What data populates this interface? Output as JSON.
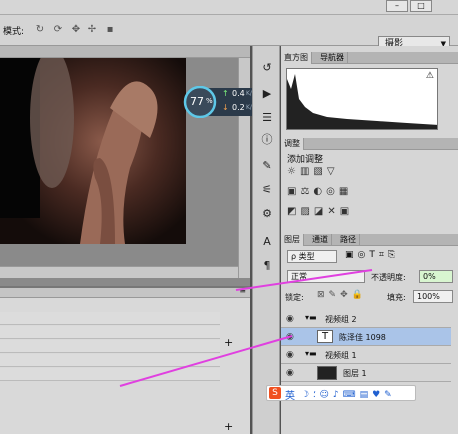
{
  "options": {
    "mode_label": "模式:",
    "workspace": "摄影"
  },
  "hud": {
    "cpu": "77",
    "cpu_unit": "%",
    "up": "0.4",
    "up_unit": "K/s",
    "down": "0.2",
    "down_unit": "K/s"
  },
  "panels": {
    "tabs_top": [
      "直方图",
      "导航器"
    ],
    "adjust_title": "调整",
    "adjust_add": "添加调整",
    "tabs_layers": [
      "图层",
      "通道",
      "路径"
    ]
  },
  "layers": {
    "filter": "类型",
    "blend": "正常",
    "opacity_label": "不透明度:",
    "opacity": "0%",
    "lock_label": "锁定:",
    "fill_label": "填充:",
    "fill": "100%",
    "rows": [
      {
        "name": "视频组 2",
        "type": "group"
      },
      {
        "name": "陈泽佳 1098",
        "type": "text"
      },
      {
        "name": "视频组 1",
        "type": "group"
      },
      {
        "name": "图层 1",
        "type": "image"
      }
    ]
  },
  "ime": {
    "lang": "英"
  },
  "colors": {
    "accent": "#e040e0",
    "sel": "#aac4e8"
  }
}
